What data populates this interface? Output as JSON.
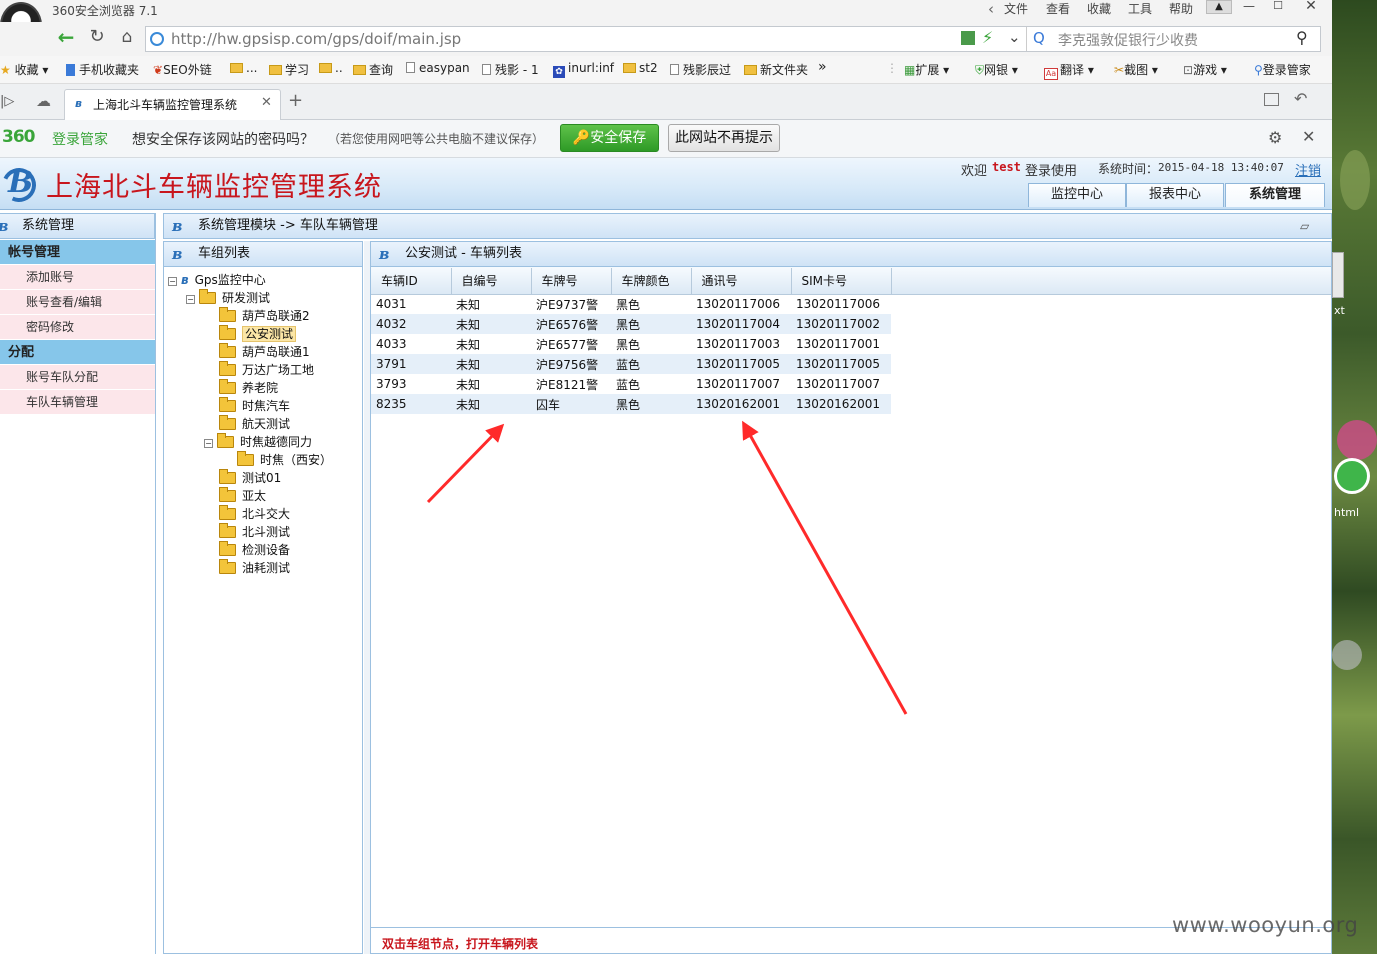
{
  "browser": {
    "title": "360安全浏览器 7.1",
    "menu": [
      "文件",
      "查看",
      "收藏",
      "工具",
      "帮助"
    ],
    "url": "http://hw.gpsisp.com/gps/doif/main.jsp",
    "search_placeholder": "李克强敦促银行少收费",
    "bookmarks_left": [
      {
        "label": "收藏",
        "icon": "star-icon"
      },
      {
        "label": "手机收藏夹",
        "icon": "phone-icon"
      },
      {
        "label": "SEO外链",
        "icon": "seo-icon"
      },
      {
        "label": "...",
        "icon": "folder-icon"
      },
      {
        "label": "学习",
        "icon": "folder-icon"
      },
      {
        "label": "..",
        "icon": "folder-icon"
      },
      {
        "label": "查询",
        "icon": "folder-icon"
      },
      {
        "label": "easypan",
        "icon": "page-icon"
      },
      {
        "label": "残影 - 1",
        "icon": "page-icon"
      },
      {
        "label": "inurl:inf",
        "icon": "paw-icon"
      },
      {
        "label": "st2",
        "icon": "folder-icon"
      },
      {
        "label": "残影辰过",
        "icon": "page-icon"
      },
      {
        "label": "新文件夹",
        "icon": "folder-icon"
      }
    ],
    "more_glyph": "»",
    "bookmarks_right": [
      "扩展",
      "网银",
      "翻译",
      "截图",
      "游戏",
      "登录管家"
    ],
    "tab_title": "上海北斗车辆监控管理系统",
    "pw_bar": {
      "brand_num": "360",
      "brand_text": "登录管家",
      "prompt": "想安全保存该网站的密码吗？",
      "hint": "（若您使用网吧等公共电脑不建议保存）",
      "save_label": "安全保存",
      "never_label": "此网站不再提示"
    }
  },
  "app": {
    "title": "上海北斗车辆监控管理系统",
    "welcome": "欢迎",
    "user": "test",
    "login_text": "登录使用",
    "time_label": "系统时间：",
    "time_value": "2015-04-18 13:40:07",
    "logout": "注销",
    "nav_tabs": [
      "监控中心",
      "报表中心",
      "系统管理"
    ],
    "active_tab": 2
  },
  "sidebar": {
    "title": "系统管理",
    "sections": [
      {
        "label": "帐号管理",
        "items": [
          "添加账号",
          "账号查看/编辑",
          "密码修改"
        ]
      },
      {
        "label": "分配",
        "items": [
          "账号车队分配",
          "车队车辆管理"
        ]
      }
    ]
  },
  "breadcrumb": "系统管理模块 -> 车队车辆管理",
  "tree": {
    "title": "车组列表",
    "root": "Gps监控中心",
    "group": "研发测试",
    "children": [
      "葫芦岛联通2",
      "公安测试",
      "葫芦岛联通1",
      "万达广场工地",
      "养老院",
      "时焦汽车",
      "航天测试"
    ],
    "expanded_child": "时焦越德同力",
    "grandchild": "时焦（西安）",
    "more": [
      "测试01",
      "亚太",
      "北斗交大",
      "北斗测试",
      "检测设备",
      "油耗测试"
    ],
    "selected": "公安测试"
  },
  "vehicles": {
    "title": "公安测试 - 车辆列表",
    "columns": [
      "车辆ID",
      "自编号",
      "车牌号",
      "车牌颜色",
      "通讯号",
      "SIM卡号"
    ],
    "rows": [
      [
        "4031",
        "未知",
        "沪E9737警",
        "黑色",
        "13020117006",
        "13020117006"
      ],
      [
        "4032",
        "未知",
        "沪E6576警",
        "黑色",
        "13020117004",
        "13020117002"
      ],
      [
        "4033",
        "未知",
        "沪E6577警",
        "黑色",
        "13020117003",
        "13020117001"
      ],
      [
        "3791",
        "未知",
        "沪E9756警",
        "蓝色",
        "13020117005",
        "13020117005"
      ],
      [
        "3793",
        "未知",
        "沪E8121警",
        "蓝色",
        "13020117007",
        "13020117007"
      ],
      [
        "8235",
        "未知",
        "囚车",
        "黑色",
        "13020162001",
        "13020162001"
      ]
    ]
  },
  "footer_hint": "双击车组节点，打开车辆列表",
  "desktop": {
    "label_1": "xt",
    "label_2": "html"
  },
  "watermark": "www.wooyun.org",
  "colors": {
    "accent_red": "#c8161d",
    "header_blue": "#d7e9f8",
    "section_blue": "#86c6ea",
    "arrow_red": "#ff2a2a"
  }
}
